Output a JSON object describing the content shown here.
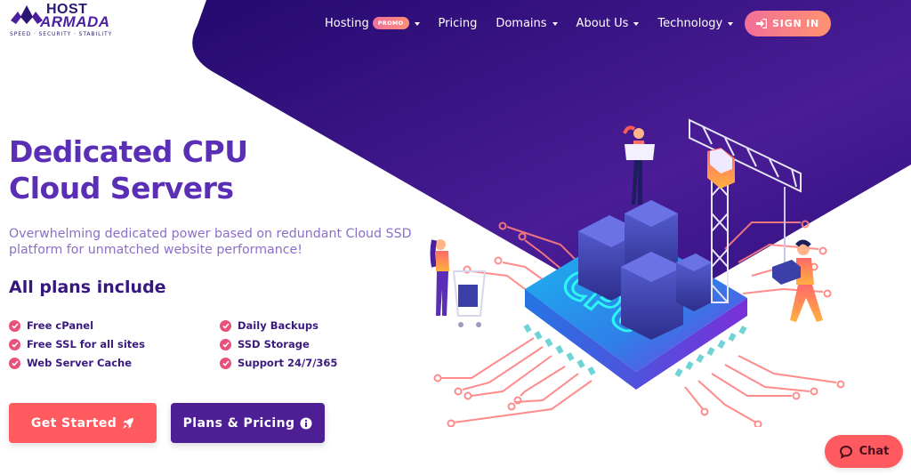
{
  "brand": {
    "name_line1": "HOST",
    "name_line2": "ARMADA",
    "tagline": "SPEED · SECURITY · STABILITY",
    "colors": {
      "primary": "#4e1e95",
      "accent": "#ff5a5f",
      "headline": "#5a2fb5",
      "check": "#e9507a"
    }
  },
  "nav": {
    "items": [
      {
        "label": "Hosting",
        "badge": "PROMO",
        "dropdown": true
      },
      {
        "label": "Pricing",
        "dropdown": false
      },
      {
        "label": "Domains",
        "dropdown": true
      },
      {
        "label": "About Us",
        "dropdown": true
      },
      {
        "label": "Technology",
        "dropdown": true
      }
    ],
    "signin_label": "SIGN IN",
    "signin_icon": "sign-in-icon"
  },
  "hero": {
    "title_line1": "Dedicated CPU",
    "title_line2": "Cloud Servers",
    "subtitle": "Overwhelming dedicated power based on redundant Cloud SSD platform for unmatched website performance!",
    "plans_heading": "All plans include",
    "features": [
      "Free cPanel",
      "Daily Backups",
      "Free SSL for all sites",
      "SSD Storage",
      "Web Server Cache",
      "Support 24/7/365"
    ],
    "feature_icon": "check-circle-icon",
    "primary_button": {
      "label": "Get Started",
      "icon": "rocket-icon"
    },
    "secondary_button": {
      "label": "Plans & Pricing",
      "icon": "info-circle-icon"
    },
    "illustration_label": "CPU"
  },
  "chat": {
    "label": "Chat",
    "icon": "chat-bubble-icon"
  }
}
